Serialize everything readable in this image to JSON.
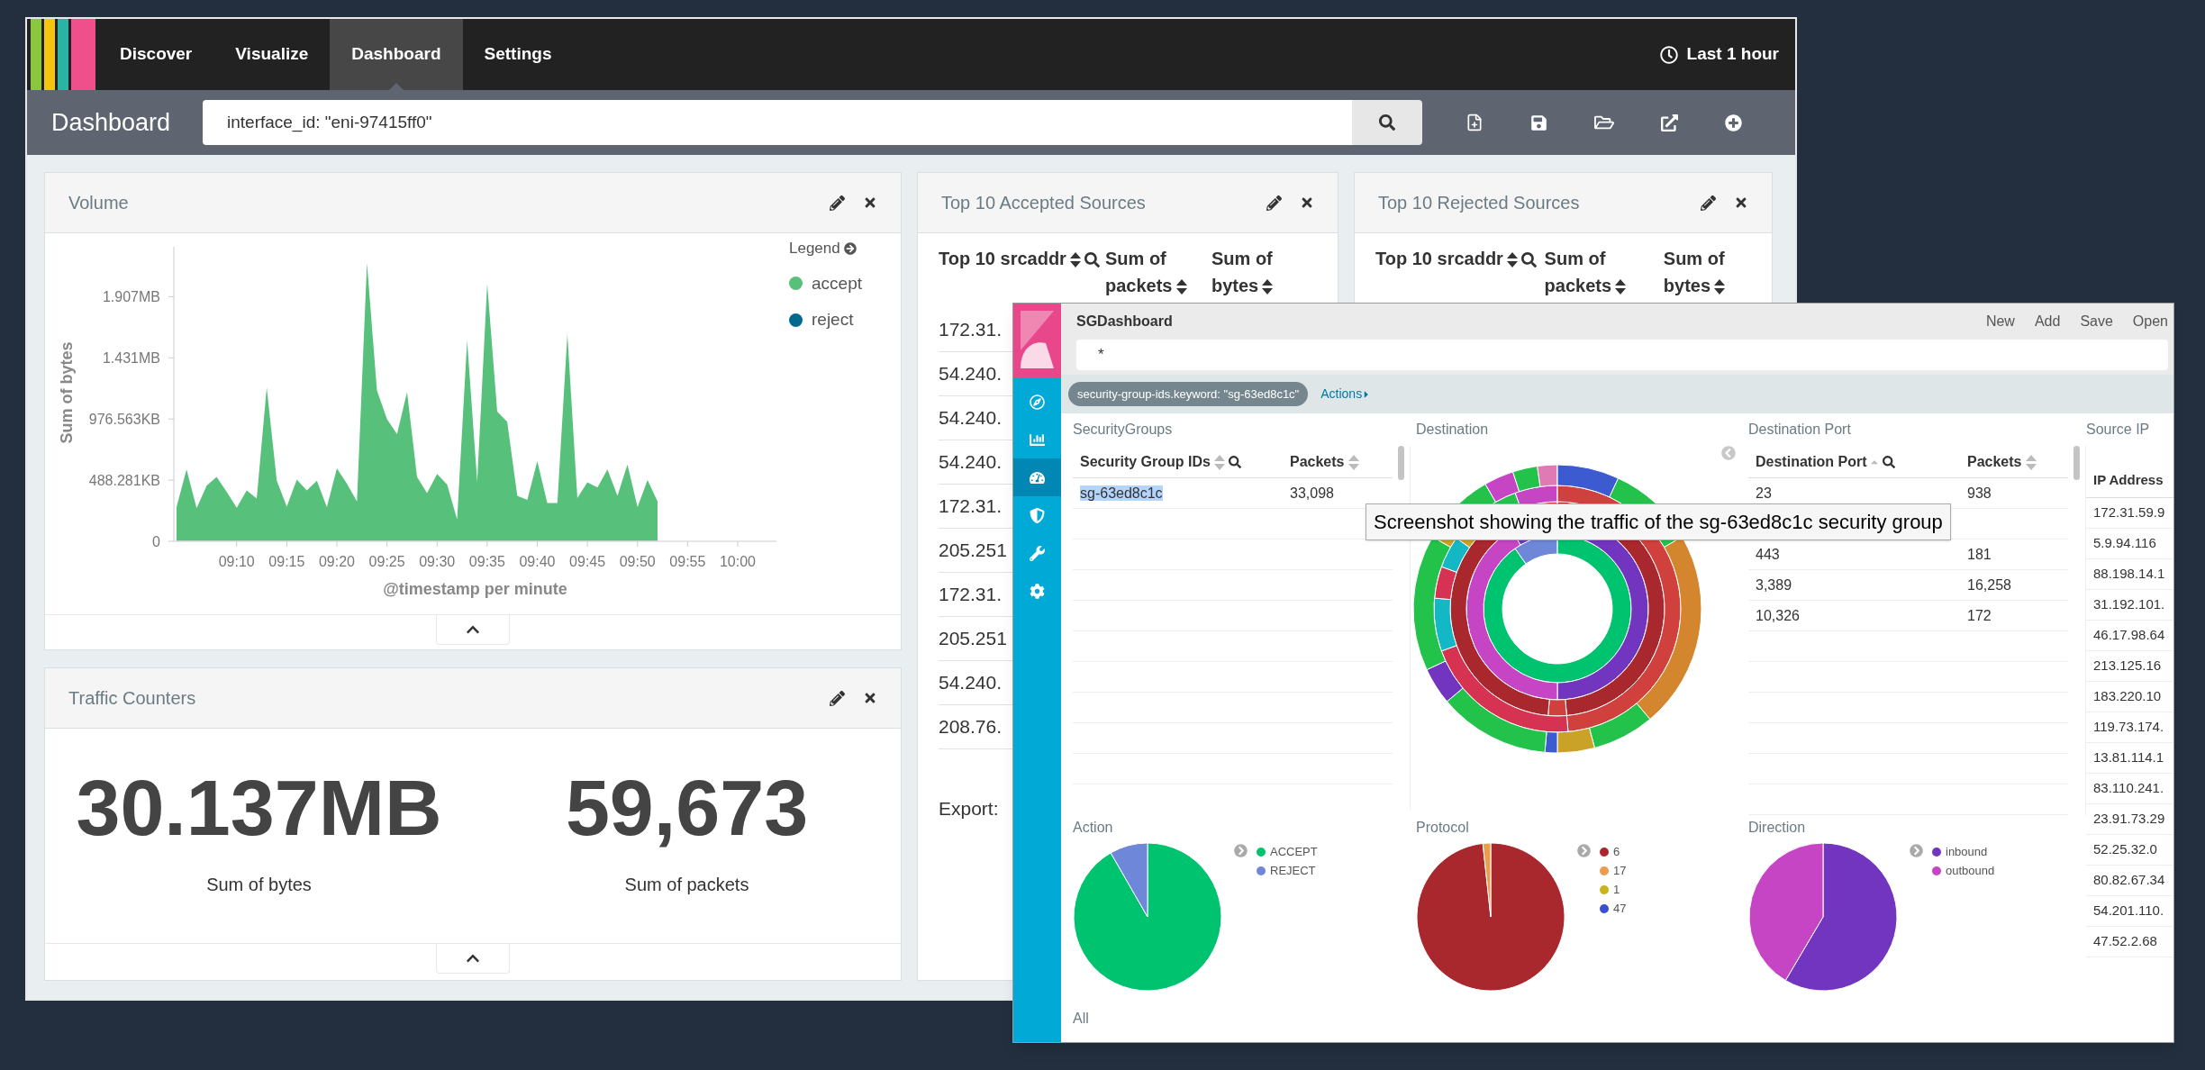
{
  "kibana": {
    "nav": {
      "tabs": [
        {
          "label": "Discover",
          "selected": false
        },
        {
          "label": "Visualize",
          "selected": false
        },
        {
          "label": "Dashboard",
          "selected": true
        },
        {
          "label": "Settings",
          "selected": false
        }
      ],
      "time": "Last 1 hour"
    },
    "toolbar": {
      "title": "Dashboard",
      "query": "interface_id: \"eni-97415ff0\""
    },
    "volume": {
      "title": "Volume",
      "legend": {
        "title": "Legend",
        "items": [
          {
            "label": "accept",
            "color": "#57c17b"
          },
          {
            "label": "reject",
            "color": "#00698c"
          }
        ]
      },
      "y_title": "Sum of bytes",
      "y_labels": [
        "1.907MB",
        "1.431MB",
        "976.563KB",
        "488.281KB",
        "0"
      ],
      "x_labels": [
        "09:10",
        "09:15",
        "09:20",
        "09:25",
        "09:30",
        "09:35",
        "09:40",
        "09:45",
        "09:50",
        "09:55",
        "10:00"
      ],
      "x_title": "@timestamp per minute"
    },
    "traffic": {
      "title": "Traffic Counters",
      "metrics": [
        {
          "value": "30.137MB",
          "label": "Sum of bytes"
        },
        {
          "value": "59,673",
          "label": "Sum of packets"
        }
      ]
    },
    "accepted": {
      "title": "Top 10 Accepted Sources",
      "columns": [
        "Top 10 srcaddr",
        "Sum of packets",
        "Sum of bytes"
      ],
      "rows": [
        "172.31.",
        "54.240.",
        "54.240.",
        "54.240.",
        "172.31.",
        "205.251",
        "172.31.",
        "205.251",
        "54.240.",
        "208.76."
      ],
      "export": "Export:"
    },
    "rejected": {
      "title": "Top 10 Rejected Sources",
      "columns": [
        "Top 10 srcaddr",
        "Sum of packets",
        "Sum of bytes"
      ]
    }
  },
  "sg_window": {
    "title": "SGDashboard",
    "menu": [
      "New",
      "Add",
      "Save",
      "Open"
    ],
    "nav": [
      {
        "kind": "compass",
        "selected": false
      },
      {
        "kind": "chart",
        "selected": false
      },
      {
        "kind": "gauge",
        "selected": true
      },
      {
        "kind": "shield",
        "selected": false
      },
      {
        "kind": "wrench",
        "selected": false
      },
      {
        "kind": "gear",
        "selected": false
      }
    ],
    "query": "*",
    "filter": {
      "label": "security-group-ids.keyword: \"sg-63ed8c1c\"",
      "actions": "Actions"
    },
    "security_groups": {
      "title": "SecurityGroups",
      "columns": [
        "Security Group IDs",
        "Packets"
      ],
      "rows": [
        {
          "id": "sg-63ed8c1c",
          "packets": "33,098",
          "highlighted": true
        }
      ]
    },
    "destination": {
      "title": "Destination"
    },
    "destination_port": {
      "title": "Destination Port",
      "columns": [
        "Destination Port",
        "Packets"
      ],
      "rows": [
        [
          "23",
          "938"
        ],
        [
          "443",
          "181"
        ],
        [
          "3,389",
          "16,258"
        ],
        [
          "10,326",
          "172"
        ]
      ]
    },
    "source_ip": {
      "title": "Source IP",
      "columns": [
        "IP Address"
      ],
      "rows": [
        "172.31.59.9",
        "5.9.94.116",
        "88.198.14.1",
        "31.192.101.",
        "46.17.98.64",
        "213.125.16",
        "183.220.10",
        "119.73.174.",
        "13.81.114.1",
        "83.110.241.",
        "23.91.73.29",
        "52.25.32.0",
        "80.82.67.34",
        "54.201.110.",
        "47.52.2.68"
      ]
    },
    "pies": [
      {
        "title": "Action",
        "legend": [
          {
            "label": "ACCEPT",
            "color": "#00c36f"
          },
          {
            "label": "REJECT",
            "color": "#6f87d8"
          }
        ]
      },
      {
        "title": "Protocol",
        "legend": [
          {
            "label": "6",
            "color": "#a8282e"
          },
          {
            "label": "17",
            "color": "#e89e4c"
          },
          {
            "label": "1",
            "color": "#c8b41a"
          },
          {
            "label": "47",
            "color": "#3c4fd1"
          }
        ]
      },
      {
        "title": "Direction",
        "legend": [
          {
            "label": "inbound",
            "color": "#7135c0"
          },
          {
            "label": "outbound",
            "color": "#c545c4"
          }
        ]
      }
    ],
    "footer": "All",
    "tooltip": "Screenshot showing the traffic of the sg-63ed8c1c security group"
  }
}
